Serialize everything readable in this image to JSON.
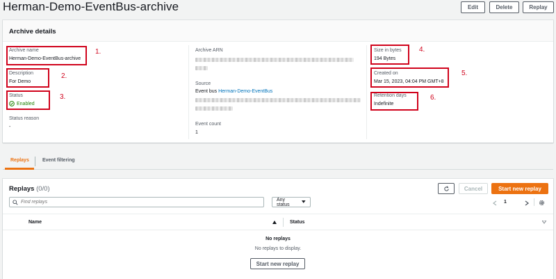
{
  "page": {
    "title": "Herman-Demo-EventBus-archive"
  },
  "toolbar": {
    "edit_label": "Edit",
    "delete_label": "Delete",
    "replay_label": "Replay"
  },
  "details": {
    "title": "Archive details",
    "archive_name_label": "Archive name",
    "archive_name_value": "Herman-Demo-EventBus-archive",
    "description_label": "Description",
    "description_value": "For Demo",
    "status_label": "Status",
    "status_value": "Enabled",
    "status_reason_label": "Status reason",
    "status_reason_value": "-",
    "arn_label": "Archive ARN",
    "source_label": "Source",
    "source_prefix": "Event bus",
    "source_link": "Herman-Demo-EventBus",
    "event_count_label": "Event count",
    "event_count_value": "1",
    "size_label": "Size in bytes",
    "size_value": "194 Bytes",
    "created_label": "Created on",
    "created_value": "Mar 15, 2023, 04:04 PM GMT+8",
    "retention_label": "Retention days",
    "retention_value": "Indefinite"
  },
  "annotations": [
    "1.",
    "2.",
    "3.",
    "4.",
    "5.",
    "6."
  ],
  "tabs": [
    {
      "label": "Replays"
    },
    {
      "label": "Event filtering"
    }
  ],
  "replays": {
    "title": "Replays",
    "count": "(0/0)",
    "refresh_icon": "refresh-icon",
    "cancel_label": "Cancel",
    "start_label": "Start new replay",
    "search_placeholder": "Find replays",
    "status_filter": "Any status",
    "page_number": "1",
    "columns": [
      "Name",
      "Status"
    ],
    "empty_title": "No replays",
    "empty_text": "No replays to display.",
    "empty_button": "Start new replay"
  },
  "colors": {
    "accent": "#ec7211",
    "link": "#0073bb",
    "success": "#1d8102",
    "annotation": "#d0021b"
  }
}
